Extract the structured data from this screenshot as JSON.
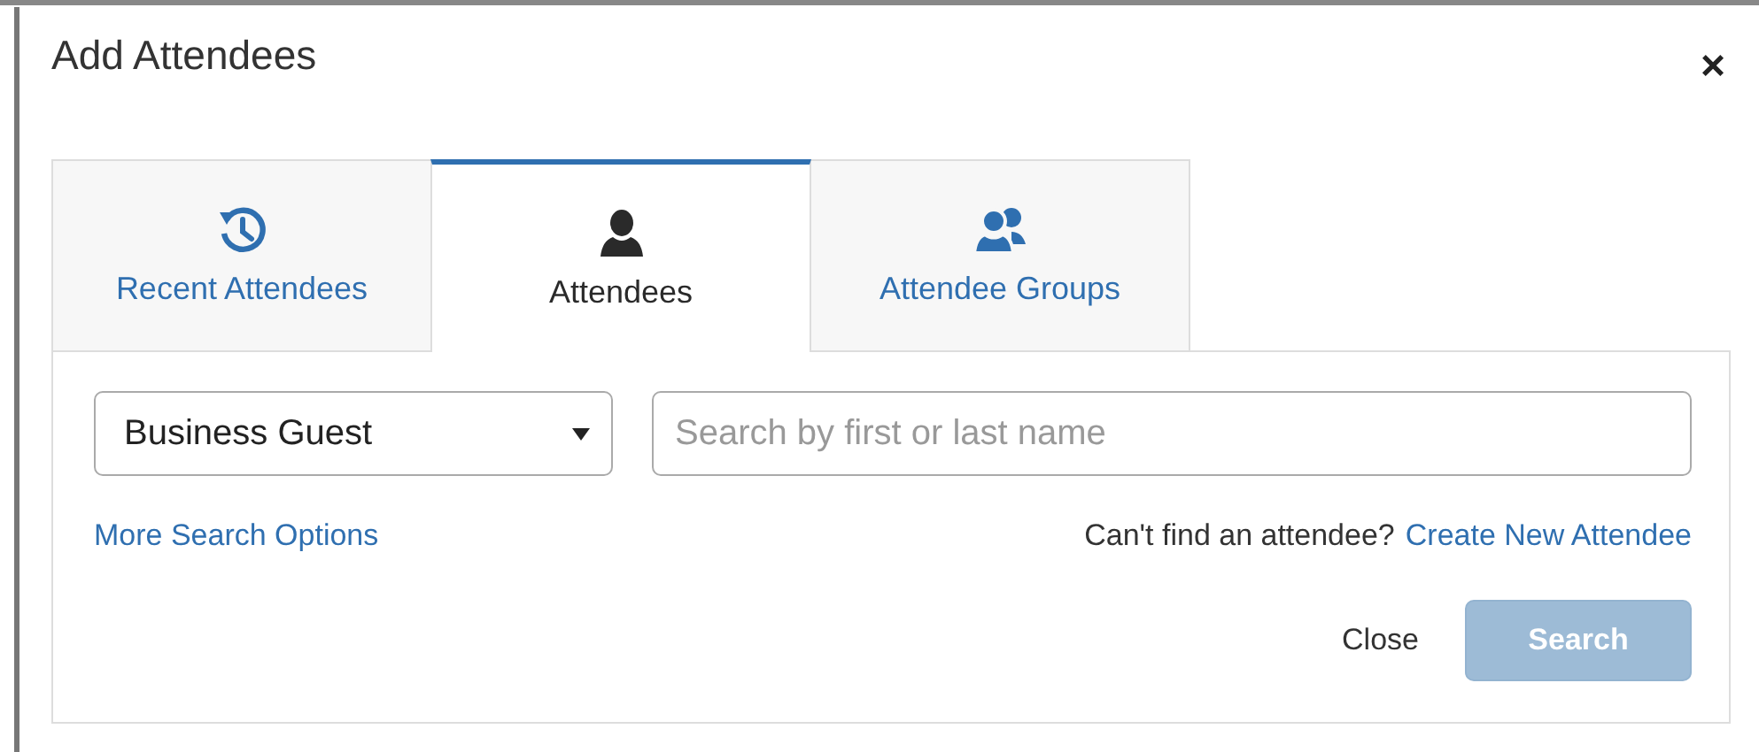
{
  "dialog": {
    "title": "Add Attendees",
    "close_label": "×"
  },
  "tabs": [
    {
      "label": "Recent Attendees",
      "kind": "history",
      "selected": false
    },
    {
      "label": "Attendees",
      "kind": "person",
      "selected": true
    },
    {
      "label": "Attendee Groups",
      "kind": "group",
      "selected": false
    }
  ],
  "search": {
    "type_select": {
      "value": "Business Guest"
    },
    "field": {
      "placeholder": "Search by first or last name"
    },
    "more_options_link": "More Search Options",
    "hint": "Can't find an attendee?",
    "create_link": "Create New Attendee"
  },
  "buttons": [
    {
      "label": "Close",
      "kind": "link",
      "disabled": false
    },
    {
      "label": "Search",
      "kind": "primary",
      "disabled": true
    }
  ]
}
